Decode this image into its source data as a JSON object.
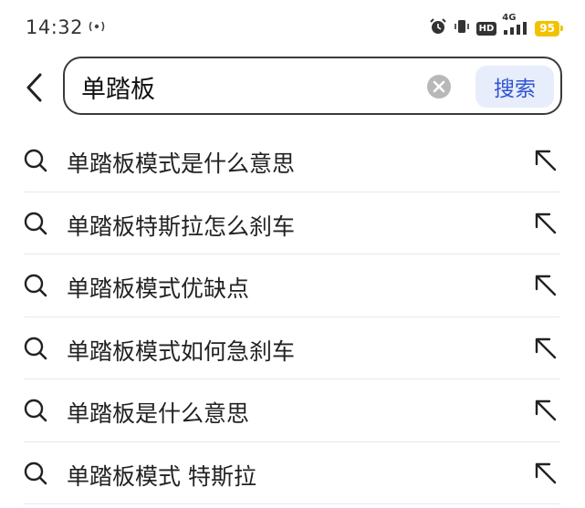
{
  "status_bar": {
    "time": "14:32",
    "hd_label": "HD",
    "network_label": "4G",
    "battery_level": "95",
    "battery_color": "#f2c200"
  },
  "search": {
    "query": "单踏板",
    "search_button_label": "搜索",
    "accent_color": "#2f55d4"
  },
  "suggestions": [
    {
      "label": "单踏板模式是什么意思"
    },
    {
      "label": "单踏板特斯拉怎么刹车"
    },
    {
      "label": "单踏板模式优缺点"
    },
    {
      "label": "单踏板模式如何急刹车"
    },
    {
      "label": "单踏板是什么意思"
    },
    {
      "label": "单踏板模式 特斯拉"
    }
  ]
}
